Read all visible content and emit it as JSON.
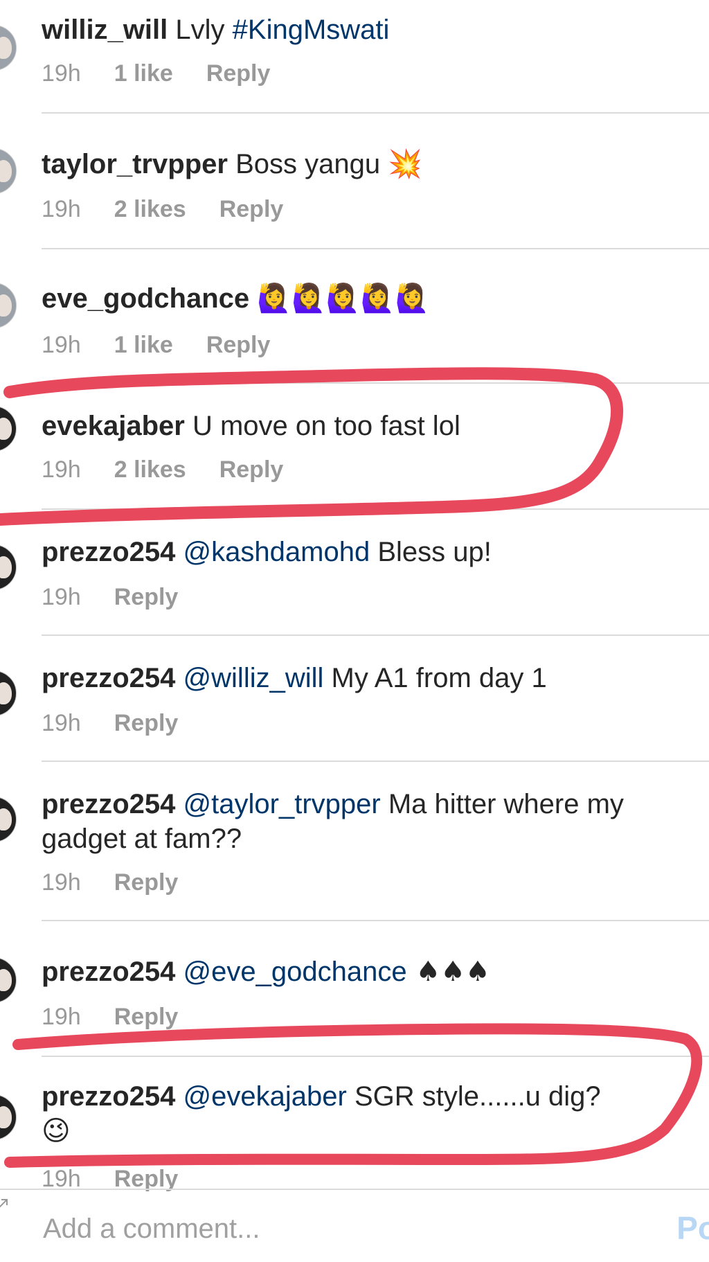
{
  "comments": [
    {
      "username": "williz_will",
      "text_before": "Lvly ",
      "tag": "#KingMswati",
      "time": "19h",
      "likes": "1 like",
      "reply": "Reply"
    },
    {
      "username": "taylor_trvpper",
      "text": "Boss yangu ",
      "emoji": "💥",
      "time": "19h",
      "likes": "2 likes",
      "reply": "Reply"
    },
    {
      "username": "eve_godchance",
      "emoji": "🙋‍♀️🙋‍♀️🙋‍♀️🙋‍♀️🙋‍♀️",
      "time": "19h",
      "likes": "1 like",
      "reply": "Reply"
    },
    {
      "username": "evekajaber",
      "text": "U move on too fast lol",
      "time": "19h",
      "likes": "2 likes",
      "reply": "Reply"
    },
    {
      "username": "prezzo254",
      "mention": "@kashdamohd",
      "text": " Bless up!",
      "time": "19h",
      "reply": "Reply"
    },
    {
      "username": "prezzo254",
      "mention": "@williz_will",
      "text": " My A1 from day 1",
      "time": "19h",
      "reply": "Reply"
    },
    {
      "username": "prezzo254",
      "mention": "@taylor_trvpper",
      "text": " Ma hitter where my gadget at fam??",
      "time": "19h",
      "reply": "Reply"
    },
    {
      "username": "prezzo254",
      "mention": "@eve_godchance",
      "emoji": " ♠♠♠",
      "time": "19h",
      "reply": "Reply"
    },
    {
      "username": "prezzo254",
      "mention": "@evekajaber",
      "text": " SGR style......u dig?",
      "emoji": "😉",
      "time": "19h",
      "reply": "Reply"
    }
  ],
  "footer": {
    "placeholder": "Add a comment...",
    "post_label": "Po"
  },
  "colors": {
    "text": "#262626",
    "mention": "#003569",
    "meta": "#999999",
    "separator": "#dbdbdb",
    "highlight_marker": "#e8485c"
  }
}
